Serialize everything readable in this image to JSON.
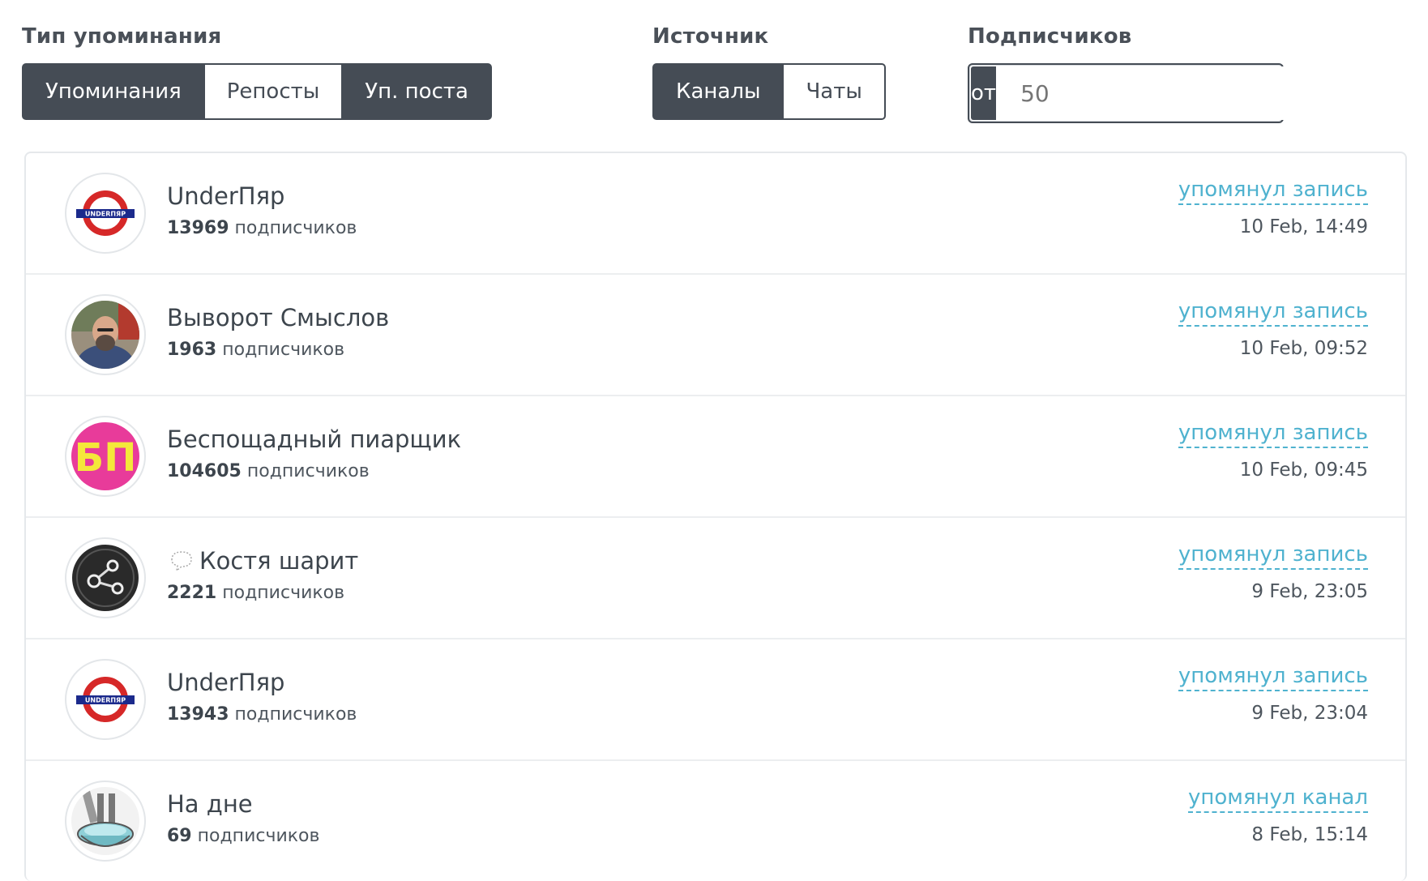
{
  "filters": {
    "mention_type": {
      "label": "Тип упоминания",
      "options": [
        "Упоминания",
        "Репосты",
        "Уп. поста"
      ],
      "active": [
        0,
        2
      ]
    },
    "source": {
      "label": "Источник",
      "options": [
        "Каналы",
        "Чаты"
      ],
      "active": [
        0
      ]
    },
    "subscribers": {
      "label": "Подписчиков",
      "prefix": "от",
      "placeholder": "50"
    }
  },
  "mentions": [
    {
      "name": "UnderПяр",
      "count": "13969",
      "subs_label": "подписчиков",
      "action": "упомянул запись",
      "time": "10 Feb, 14:49",
      "avatar": "underground-logo-icon"
    },
    {
      "name": "Выворот Смыслов",
      "count": "1963",
      "subs_label": "подписчиков",
      "action": "упомянул запись",
      "time": "10 Feb, 09:52",
      "avatar": "person-photo-icon"
    },
    {
      "name": "Беспощадный пиарщик",
      "count": "104605",
      "subs_label": "подписчиков",
      "action": "упомянул запись",
      "time": "10 Feb, 09:45",
      "avatar": "bp-logo-icon",
      "avatar_text": "БП"
    },
    {
      "name": "Костя шарит",
      "count": "2221",
      "subs_label": "подписчиков",
      "action": "упомянул запись",
      "time": "9 Feb, 23:05",
      "avatar": "share-icon"
    },
    {
      "name": "UnderПяр",
      "count": "13943",
      "subs_label": "подписчиков",
      "action": "упомянул запись",
      "time": "9 Feb, 23:04",
      "avatar": "underground-logo-icon"
    },
    {
      "name": "На дне",
      "count": "69",
      "subs_label": "подписчиков",
      "action": "упомянул канал",
      "time": "8 Feb, 15:14",
      "avatar": "basin-illustration-icon"
    }
  ],
  "logo_text": "UNDERПЯР",
  "colors": {
    "dark": "#454c55",
    "accent": "#4fb2cf",
    "bp_pink": "#e83b9a",
    "bp_yellow": "#f4e83a"
  }
}
